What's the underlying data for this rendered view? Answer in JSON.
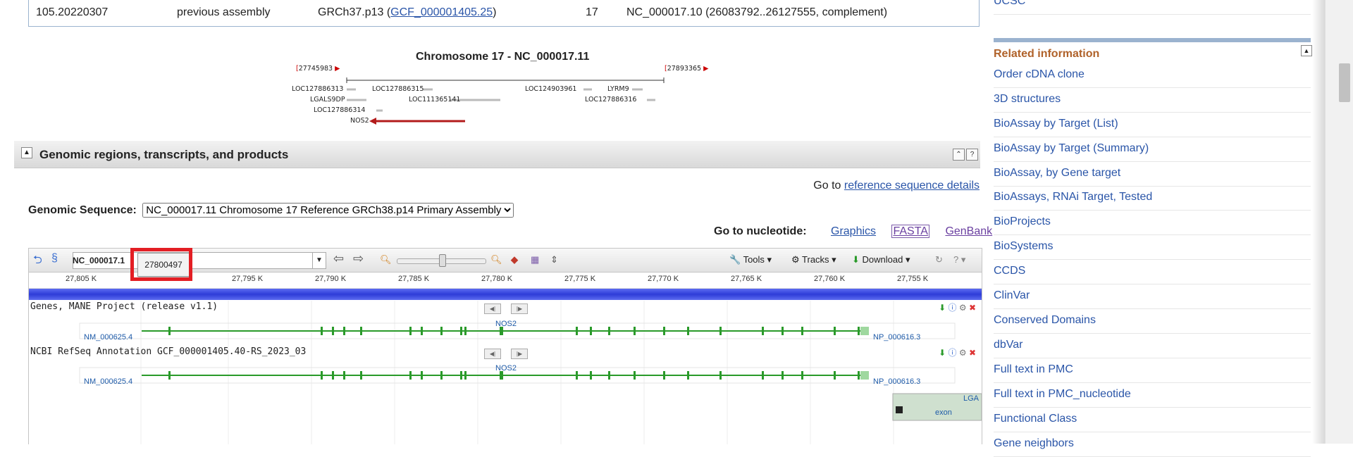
{
  "top_row": {
    "version": "105.20220307",
    "status": "previous assembly",
    "assembly_prefix": "GRCh37.p13 (",
    "assembly_link": "GCF_000001405.25",
    "assembly_suffix": ")",
    "chr": "17",
    "location": "NC_000017.10 (26083792..26127555, complement)"
  },
  "chromosome": {
    "title": "Chromosome 17 - NC_000017.11",
    "left_coord": "27745983",
    "right_coord": "27893365",
    "genes": [
      "LOC127886313",
      "LOC127886315",
      "LOC124903961",
      "LYRM9",
      "LGALS9DP",
      "LOC111365141",
      "LOC127886316",
      "LOC127886314",
      "NOS2"
    ]
  },
  "section": {
    "title": "Genomic regions, transcripts, and products",
    "btn_up": "⌃",
    "btn_help": "?"
  },
  "goto_ref": {
    "prefix": "Go to ",
    "link": "reference sequence details"
  },
  "genomic_sequence": {
    "label": "Genomic Sequence:",
    "selected": "NC_000017.11 Chromosome 17 Reference GRCh38.p14 Primary Assembly"
  },
  "goto_nucleotide": {
    "label": "Go to nucleotide:",
    "links": [
      "Graphics",
      "FASTA",
      "GenBank"
    ]
  },
  "viewer": {
    "seq_label": "NC_000017.1",
    "tools": "Tools",
    "tracks": "Tracks",
    "download": "Download",
    "ruler": [
      "27,805 K",
      "27,795 K",
      "27,790 K",
      "27,785 K",
      "27,780 K",
      "27,775 K",
      "27,770 K",
      "27,765 K",
      "27,760 K",
      "27,755 K"
    ],
    "track1": {
      "title": "Genes, MANE Project (release v1.1)",
      "gene": "NOS2",
      "left": "NM_000625.4",
      "right": "NP_000616.3"
    },
    "track2": {
      "title": "NCBI RefSeq Annotation GCF_000001405.40-RS_2023_03",
      "gene": "NOS2",
      "left": "NM_000625.4",
      "right": "NP_000616.3"
    },
    "mini_label": "LGA",
    "exon_label": "exon"
  },
  "tooltip": "27800497",
  "sidebar": {
    "top_item": "UCSC",
    "related_title": "Related information",
    "items": [
      "Order cDNA clone",
      "3D structures",
      "BioAssay by Target (List)",
      "BioAssay by Target (Summary)",
      "BioAssay, by Gene target",
      "BioAssays, RNAi Target, Tested",
      "BioProjects",
      "BioSystems",
      "CCDS",
      "ClinVar",
      "Conserved Domains",
      "dbVar",
      "Full text in PMC",
      "Full text in PMC_nucleotide",
      "Functional Class",
      "Gene neighbors"
    ]
  }
}
